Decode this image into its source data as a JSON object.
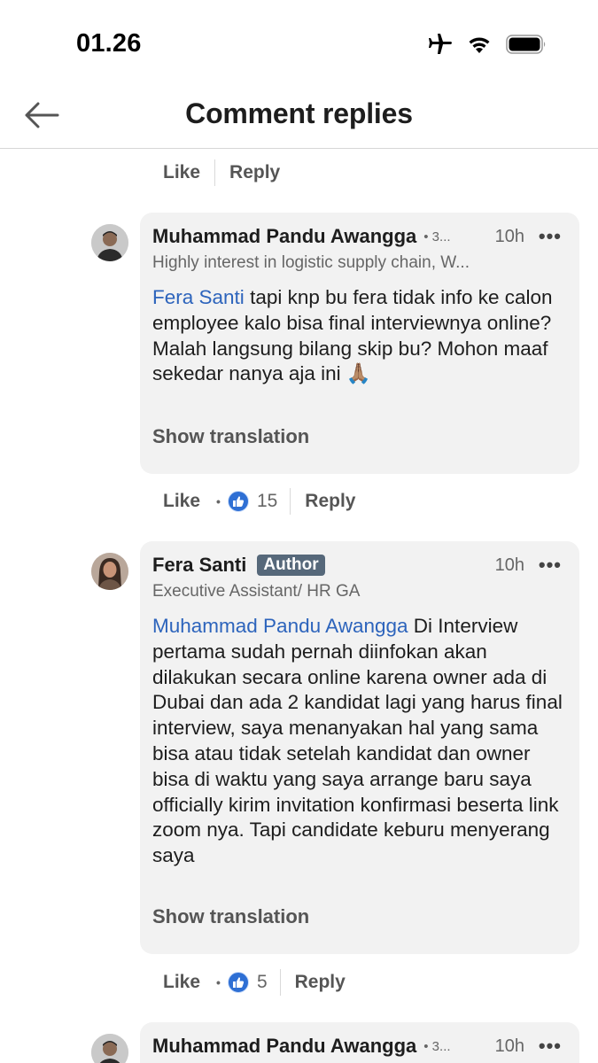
{
  "status_bar": {
    "time": "01.26"
  },
  "header": {
    "title": "Comment replies"
  },
  "top_actions": {
    "like": "Like",
    "reply": "Reply"
  },
  "comments": [
    {
      "author": "Muhammad Pandu Awangga",
      "degree": "• 3...",
      "time": "10h",
      "more": "•••",
      "headline": "Highly interest in logistic supply chain, W...",
      "mention": "Fera Santi",
      "body": " tapi knp bu fera tidak info ke calon employee kalo bisa final interviewnya online? Malah langsung bilang skip bu? Mohon maaf sekedar nanya aja ini 🙏🏽",
      "show_translation": "Show translation",
      "like_label": "Like",
      "like_count": "15",
      "reply_label": "Reply"
    },
    {
      "author": "Fera Santi",
      "badge": "Author",
      "time": "10h",
      "more": "•••",
      "headline": "Executive Assistant/ HR GA",
      "mention": "Muhammad Pandu Awangga",
      "body": " Di Interview pertama sudah pernah diinfokan akan dilakukan secara online karena owner ada di Dubai dan ada 2 kandidat lagi yang harus final interview, saya menanyakan hal yang sama bisa atau tidak setelah kandidat dan owner bisa di waktu yang saya arrange baru saya officially kirim invitation konfirmasi beserta link zoom nya. Tapi candidate keburu menyerang saya",
      "show_translation": "Show translation",
      "like_label": "Like",
      "like_count": "5",
      "reply_label": "Reply"
    },
    {
      "author": "Muhammad Pandu Awangga",
      "degree": "• 3...",
      "time": "10h",
      "more": "•••"
    }
  ]
}
